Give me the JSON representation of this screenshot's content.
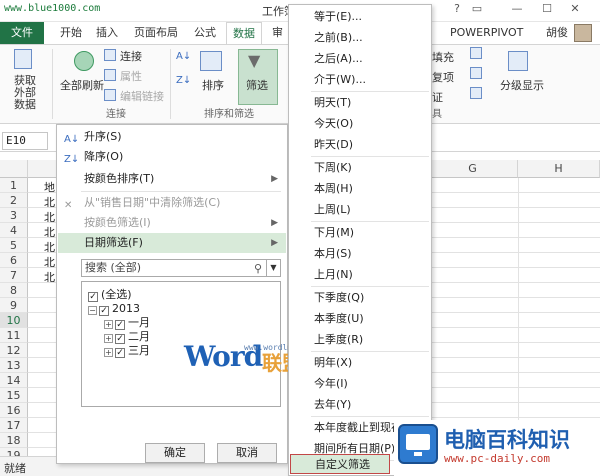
{
  "watermark_top": "www.blue1000.com",
  "title_bar": {
    "title": "工作簿1"
  },
  "window_buttons": {
    "help": "?",
    "restore": "▭",
    "minimize": "—",
    "maximize": "☐",
    "close": "✕"
  },
  "tabs": {
    "file": "文件",
    "home": "开始",
    "insert": "插入",
    "page_layout": "页面布局",
    "formulas": "公式",
    "data": "数据",
    "review": "审阅",
    "powerpivot": "POWERPIVOT",
    "user": "胡俊"
  },
  "ribbon": {
    "get_external": "获取\n外部数据",
    "get_external_line1": "获取",
    "get_external_line2": "外部数据",
    "refresh_all": "全部刷新",
    "connections": "连接",
    "properties": "属性",
    "edit_links": "编辑链接",
    "connections_group": "连接",
    "sort": "排序",
    "filter": "筛选",
    "sort_filter_group": "排序和筛选",
    "fill": "填充",
    "remove_dup": "复项",
    "validate": "证",
    "tools_group": "具",
    "group_outline": "分级显示"
  },
  "namebox": "E10",
  "columns": {
    "g": "G",
    "h": "H"
  },
  "rows": [
    "1",
    "2",
    "3",
    "4",
    "5",
    "6",
    "7",
    "8",
    "9",
    "10",
    "11",
    "12",
    "13",
    "14",
    "15",
    "16",
    "17",
    "18",
    "19"
  ],
  "cells": {
    "r1": "地",
    "r2": "北",
    "r3": "北",
    "r4": "北",
    "r5": "北",
    "r6": "北",
    "r7": "北"
  },
  "status": "就绪",
  "filter_menu": {
    "sort_asc": "升序(S)",
    "sort_desc": "降序(O)",
    "sort_by_color": "按颜色排序(T)",
    "clear_filter": "从\"销售日期\"中清除筛选(C)",
    "filter_by_color": "按颜色筛选(I)",
    "date_filters": "日期筛选(F)",
    "search_placeholder": "搜索 (全部)",
    "tree": {
      "select_all": "(全选)",
      "year": "2013",
      "m1": "一月",
      "m2": "二月",
      "m3": "三月"
    },
    "ok": "确定",
    "cancel": "取消"
  },
  "date_menu": {
    "equals": "等于(E)...",
    "before": "之前(B)...",
    "after": "之后(A)...",
    "between": "介于(W)...",
    "tomorrow": "明天(T)",
    "today": "今天(O)",
    "yesterday": "昨天(D)",
    "next_week": "下周(K)",
    "this_week": "本周(H)",
    "last_week": "上周(L)",
    "next_month": "下月(M)",
    "this_month": "本月(S)",
    "last_month": "上月(N)",
    "next_quarter": "下季度(Q)",
    "this_quarter": "本季度(U)",
    "last_quarter": "上季度(R)",
    "next_year": "明年(X)",
    "this_year": "今年(I)",
    "last_year": "去年(Y)",
    "ytd": "本年度截止到现在(A)",
    "all_dates": "期间所有日期(P)",
    "custom": "自定义筛选(F)..."
  },
  "watermark_word": {
    "word": "Word",
    "lianmeng": "联盟",
    "url": "www.wordlm.com"
  },
  "brand": {
    "name": "电脑百科知识",
    "url": "www.pc-daily.com"
  }
}
